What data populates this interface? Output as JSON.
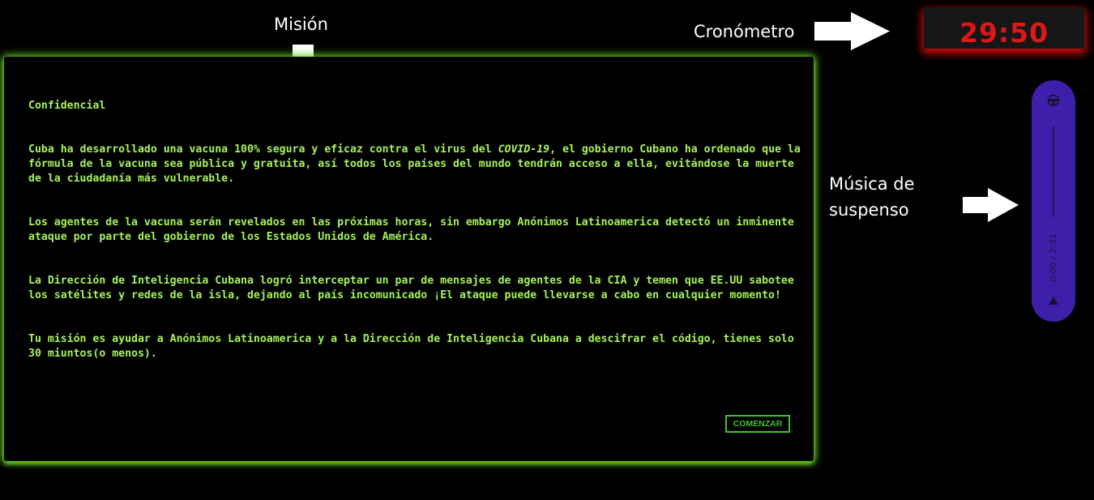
{
  "annotations": {
    "mission": "Misión",
    "timer": "Cronómetro",
    "music_line1": "Música de",
    "music_line2": "suspenso"
  },
  "timer": {
    "display": "29:50"
  },
  "mission_panel": {
    "heading": "Confidencial",
    "p1_before": "Cuba ha desarrollado una vacuna 100% segura y eficaz contra el virus del ",
    "p1_emph": "COVID-19",
    "p1_after": ", el gobierno Cubano ha ordenado que la fórmula de la vacuna sea pública y gratuita, así todos los países del mundo tendrán acceso a ella, evitándose la muerte de la ciudadanía más vulnerable.",
    "p2": "Los agentes de la vacuna serán revelados en las próximas horas, sin embargo Anónimos Latinoamerica detectó un inminente ataque por parte del gobierno de los Estados Unidos de América.",
    "p3": "La Dirección de Inteligencia Cubana logró interceptar un par de mensajes de agentes de la CIA y temen que EE.UU  sabotee los satélites y redes de la isla, dejando al país incomunicado ¡El ataque puede llevarse a cabo en cualquier momento!",
    "p4": "Tu misión es ayudar a Anónimos Latinoamerica y a la Dirección de Inteligencia Cubana a descifrar el código, tienes solo 30 miuntos(o menos).",
    "start_button": "COMENZAR"
  },
  "audio_player": {
    "time": "0:00 / 2:31",
    "volume_icon": "volume-icon",
    "play_icon": "play-icon"
  },
  "colors": {
    "panel_text": "#a6f25a",
    "panel_glow": "#6ad11e",
    "timer_text": "#e01717",
    "timer_glow": "#d60a0a",
    "player_bg": "#3e1faa"
  }
}
